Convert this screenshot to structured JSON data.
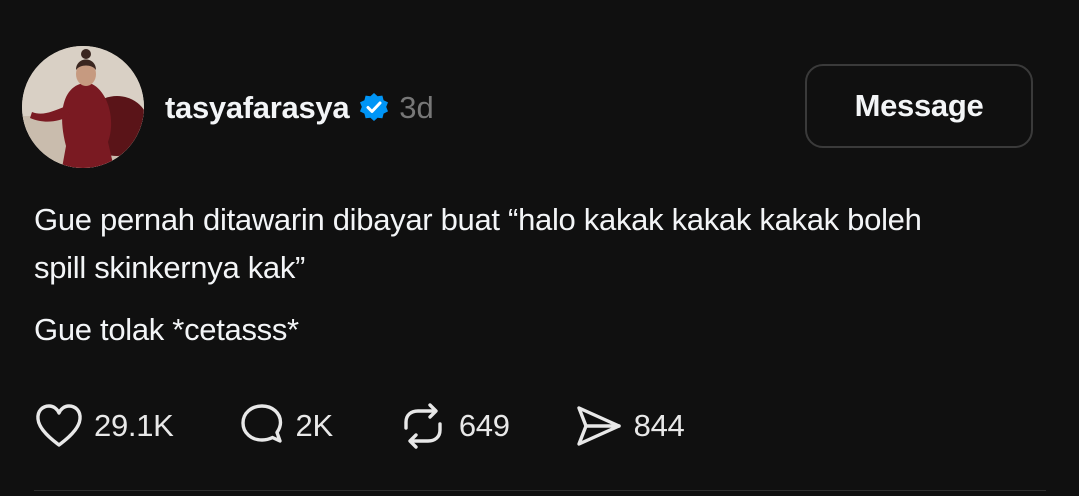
{
  "post": {
    "username": "tasyafarasya",
    "time": "3d",
    "message_button": "Message",
    "paragraphs": [
      "Gue pernah ditawarin dibayar buat “halo kakak kakak kakak boleh spill skinkernya kak”",
      "Gue tolak *cetasss*"
    ],
    "actions": {
      "likes": "29.1K",
      "replies": "2K",
      "reposts": "649",
      "shares": "844"
    }
  },
  "icons": {
    "verified": "verified-badge-icon",
    "like": "heart-icon",
    "reply": "speech-bubble-icon",
    "repost": "repost-icon",
    "share": "send-icon"
  },
  "colors": {
    "background": "#101010",
    "text": "#f3f5f7",
    "muted": "#777777",
    "verified": "#0095f6",
    "button_border": "#3a3a3a"
  }
}
